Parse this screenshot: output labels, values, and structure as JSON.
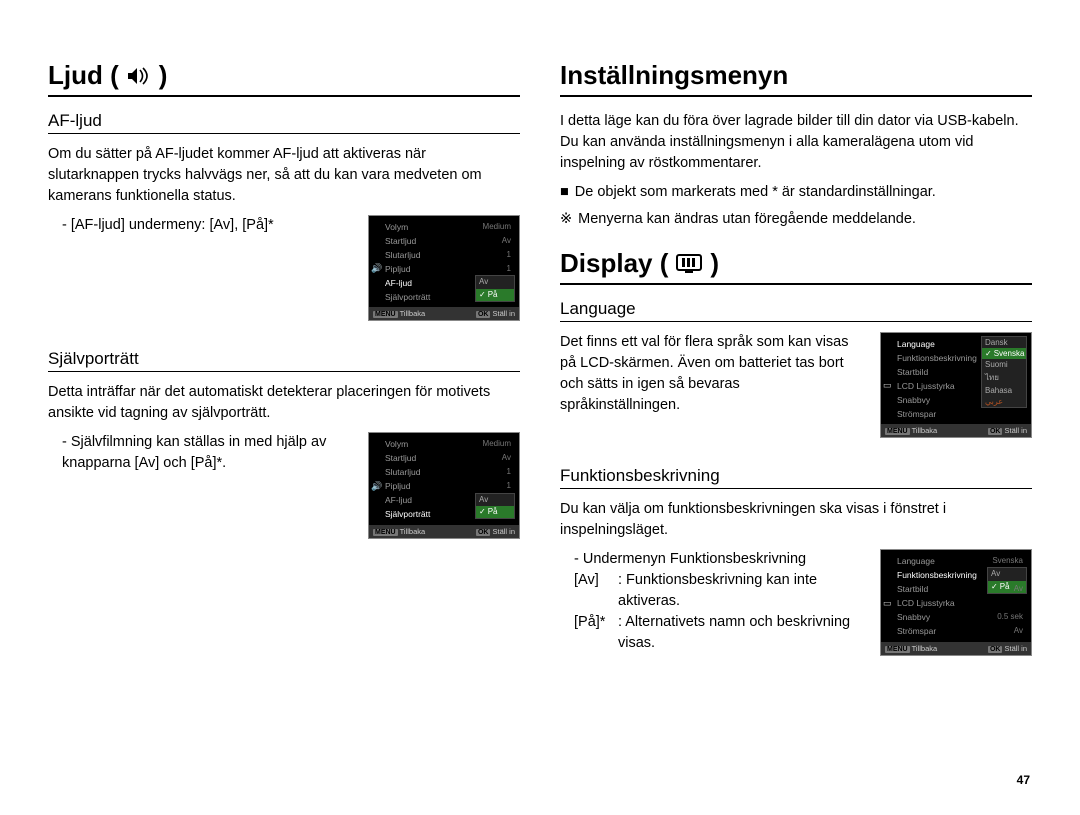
{
  "pagenum": "47",
  "left": {
    "title_prefix": "Ljud (",
    "title_suffix": " )",
    "af": {
      "heading": "AF-ljud",
      "body": "Om du sätter på AF-ljudet kommer AF-ljud att aktiveras när slutarknappen trycks halvvägs ner, så att du kan vara medveten om kamerans funktionella status.",
      "submenu": "- AF-ljud] undermeny: [Av], [På]*",
      "submenu_pre": "- [AF-ljud] undermeny: [Av], [På]*"
    },
    "sp": {
      "heading": "Självporträtt",
      "body": "Detta inträffar när det automatiskt detekterar placeringen för motivets ansikte vid tagning av självporträtt.",
      "submenu": "- Självfilmning kan ställas in med hjälp av knapparna [Av] och [På]*."
    },
    "cam_sound": {
      "rows": [
        {
          "label": "Volym",
          "value": "Medium"
        },
        {
          "label": "Startljud",
          "value": "Av"
        },
        {
          "label": "Slutarljud",
          "value": "1"
        },
        {
          "label": "Pipljud",
          "value": "1"
        },
        {
          "label": "AF-ljud",
          "value": ""
        },
        {
          "label": "Självporträtt",
          "value": ""
        }
      ],
      "popup": [
        "Av",
        "På"
      ],
      "foot_left_btn": "MENU",
      "foot_left": "Tillbaka",
      "foot_right_btn": "OK",
      "foot_right": "Ställ in"
    }
  },
  "right": {
    "settings_title": "Inställningsmenyn",
    "settings_body": "I detta läge kan du föra över lagrade bilder till din dator via USB-kabeln. Du kan använda inställningsmenyn i alla kameralägena utom vid inspelning av röstkommentarer.",
    "bullet1_sym": "■",
    "bullet1": "De objekt som markerats med * är standardinställningar.",
    "bullet2_sym": "※",
    "bullet2": "Menyerna kan ändras utan föregående meddelande.",
    "display_title_prefix": "Display (",
    "display_title_suffix": " )",
    "language": {
      "heading": "Language",
      "body": "Det finns ett val för flera språk som kan visas på LCD-skärmen. Även om batteriet tas bort och sätts in igen så bevaras språkinställningen."
    },
    "funk": {
      "heading": "Funktionsbeskrivning",
      "body": "Du kan välja om funktionsbeskrivningen ska visas i fönstret i inspelningsläget.",
      "sublabel": "- Undermenyn Funktionsbeskrivning",
      "av_label": "[Av]",
      "av_desc": ": Funktionsbeskrivning kan inte aktiveras.",
      "pa_label": "[På]*",
      "pa_desc": ": Alternativets namn och beskrivning visas."
    },
    "cam_lang": {
      "rows": [
        {
          "label": "Language",
          "value": ""
        },
        {
          "label": "Funktionsbeskrivning",
          "value": ""
        },
        {
          "label": "Startbild",
          "value": ""
        },
        {
          "label": "LCD Ljusstyrka",
          "value": ""
        },
        {
          "label": "Snabbvy",
          "value": ""
        },
        {
          "label": "Strömspar",
          "value": ""
        }
      ],
      "popup": [
        "Dansk",
        "Svenska",
        "Suomi",
        "ไทย",
        "Bahasa",
        "عربي"
      ],
      "foot_left_btn": "MENU",
      "foot_left": "Tillbaka",
      "foot_right_btn": "OK",
      "foot_right": "Ställ in"
    },
    "cam_funk": {
      "rows": [
        {
          "label": "Language",
          "value": "Svenska"
        },
        {
          "label": "Funktionsbeskrivning",
          "value": ""
        },
        {
          "label": "Startbild",
          "value": "Av"
        },
        {
          "label": "LCD Ljusstyrka",
          "value": ""
        },
        {
          "label": "Snabbvy",
          "value": "0.5 sek"
        },
        {
          "label": "Strömspar",
          "value": "Av"
        }
      ],
      "popup": [
        "Av",
        "På"
      ],
      "foot_left_btn": "MENU",
      "foot_left": "Tillbaka",
      "foot_right_btn": "OK",
      "foot_right": "Ställ in"
    }
  }
}
